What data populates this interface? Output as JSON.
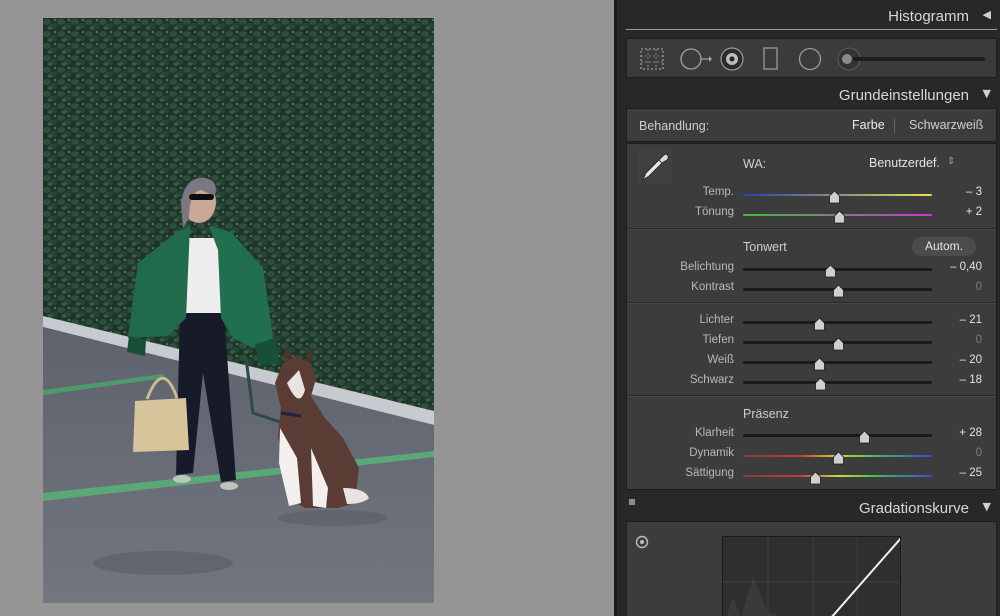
{
  "panel": {
    "histogram": {
      "title": "Histogramm",
      "toggle": "◀"
    },
    "basic": {
      "title": "Grundeinstellungen",
      "toggle": "▼",
      "treatment": {
        "label": "Behandlung:",
        "color": "Farbe",
        "bw": "Schwarzweiß"
      },
      "wb": {
        "label": "WA:",
        "preset": "Benutzerdef.",
        "preset_arrows": "⇕",
        "sliders": [
          {
            "name": "Temp.",
            "value": "– 3",
            "level": 0.48
          },
          {
            "name": "Tönung",
            "value": "+ 2",
            "level": 0.51
          }
        ]
      },
      "tone": {
        "label": "Tonwert",
        "auto": "Autom.",
        "sliders": [
          {
            "name": "Belichtung",
            "value": "– 0,40",
            "level": 0.46
          },
          {
            "name": "Kontrast",
            "value": "0",
            "level": 0.5
          }
        ],
        "sliders2": [
          {
            "name": "Lichter",
            "value": "– 21",
            "level": 0.4
          },
          {
            "name": "Tiefen",
            "value": "0",
            "level": 0.5
          },
          {
            "name": "Weiß",
            "value": "– 20",
            "level": 0.4
          },
          {
            "name": "Schwarz",
            "value": "– 18",
            "level": 0.41
          }
        ]
      },
      "presence": {
        "label": "Präsenz",
        "sliders": [
          {
            "name": "Klarheit",
            "value": "+ 28",
            "level": 0.64
          },
          {
            "name": "Dynamik",
            "value": "0",
            "level": 0.5
          },
          {
            "name": "Sättigung",
            "value": "– 25",
            "level": 0.38
          }
        ]
      }
    },
    "curve": {
      "title": "Gradationskurve",
      "toggle": "▼"
    }
  },
  "colors": {
    "panel_bg": "#282828",
    "section_bg": "#3c3c3c",
    "canvas_bg": "#959595",
    "ivy": "#213a2b",
    "jacket": "#1f6b4c"
  },
  "icons": [
    "crop-icon",
    "spot-removal-icon",
    "red-eye-icon",
    "graduated-filter-icon",
    "radial-filter-icon",
    "adjustment-brush-icon",
    "eyedropper-icon",
    "target-adjust-icon"
  ]
}
